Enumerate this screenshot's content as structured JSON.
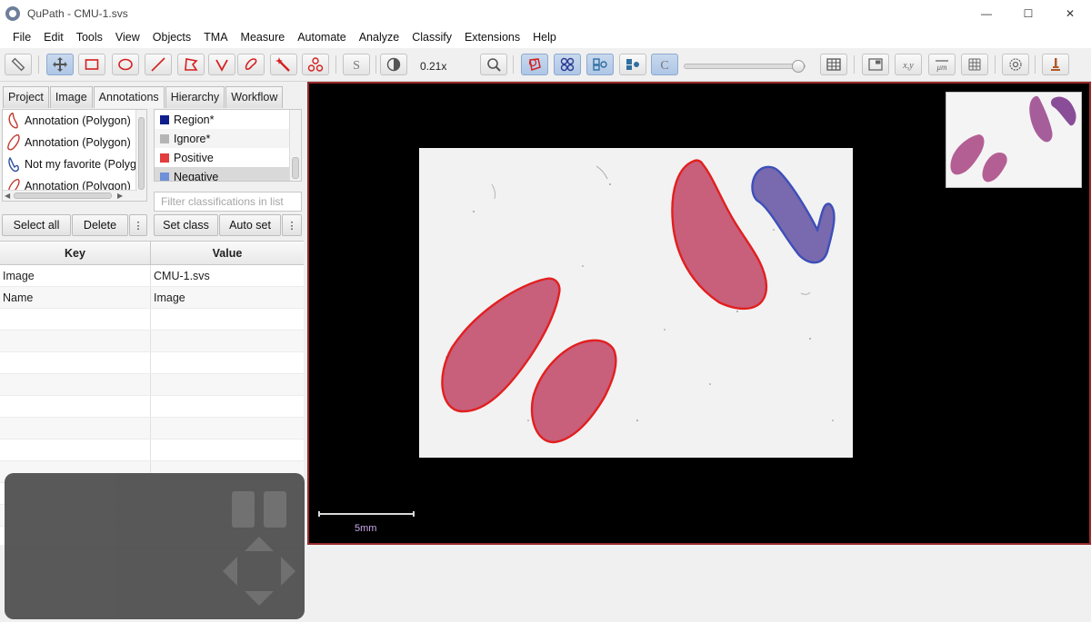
{
  "window": {
    "title": "QuPath - CMU-1.svs",
    "minimize": "—",
    "maximize": "☐",
    "close": "✕"
  },
  "menu": [
    "File",
    "Edit",
    "Tools",
    "View",
    "Objects",
    "TMA",
    "Measure",
    "Automate",
    "Analyze",
    "Classify",
    "Extensions",
    "Help"
  ],
  "toolbar": {
    "zoom_level": "0.21x",
    "opacity_value": 0.95,
    "icons": [
      "ruler-icon",
      "move-icon",
      "rectangle-icon",
      "ellipse-icon",
      "line-icon",
      "polygon-icon",
      "polyline-icon",
      "brush-icon",
      "wand-icon",
      "points-icon",
      "selection-mode-icon",
      "brightness-contrast-icon",
      "zoom-fit-icon",
      "show-annotations-icon",
      "show-tma-grid-icon",
      "show-detections-icon",
      "fill-detections-icon",
      "pixel-classification-icon",
      "measurement-table-icon",
      "overview-icon",
      "cursor-location-icon",
      "scalebar-icon",
      "grid-icon",
      "preferences-icon",
      "log-icon"
    ]
  },
  "tabs": [
    "Project",
    "Image",
    "Annotations",
    "Hierarchy",
    "Workflow"
  ],
  "active_tab": "Annotations",
  "annotations": [
    {
      "label": "Annotation (Polygon)",
      "color": "#c0392b"
    },
    {
      "label": "Annotation (Polygon)",
      "color": "#c0392b"
    },
    {
      "label": "Not my favorite (Polygon)",
      "color": "#2c4ea0"
    },
    {
      "label": "Annotation (Polygon)",
      "color": "#c0392b"
    }
  ],
  "classes": [
    {
      "label": "Region*",
      "color": "#0f1e8c"
    },
    {
      "label": "Ignore*",
      "color": "#b4b4b4"
    },
    {
      "label": "Positive",
      "color": "#e23c3c"
    },
    {
      "label": "Negative",
      "color": "#6f8fd6"
    }
  ],
  "class_filter_placeholder": "Filter classifications in list",
  "buttons": {
    "select_all": "Select all",
    "delete": "Delete",
    "set_class": "Set class",
    "auto_set": "Auto set",
    "more": "⋮"
  },
  "kv_table": {
    "headers": [
      "Key",
      "Value"
    ],
    "rows": [
      [
        "Image",
        "CMU-1.svs"
      ],
      [
        "Name",
        "Image"
      ]
    ]
  },
  "scalebar": {
    "label": "5mm"
  },
  "colors": {
    "positive": "#e23c3c",
    "negative": "#3d4fb8",
    "tissue": "#c24a6a",
    "viewer_border": "#9a2929"
  }
}
